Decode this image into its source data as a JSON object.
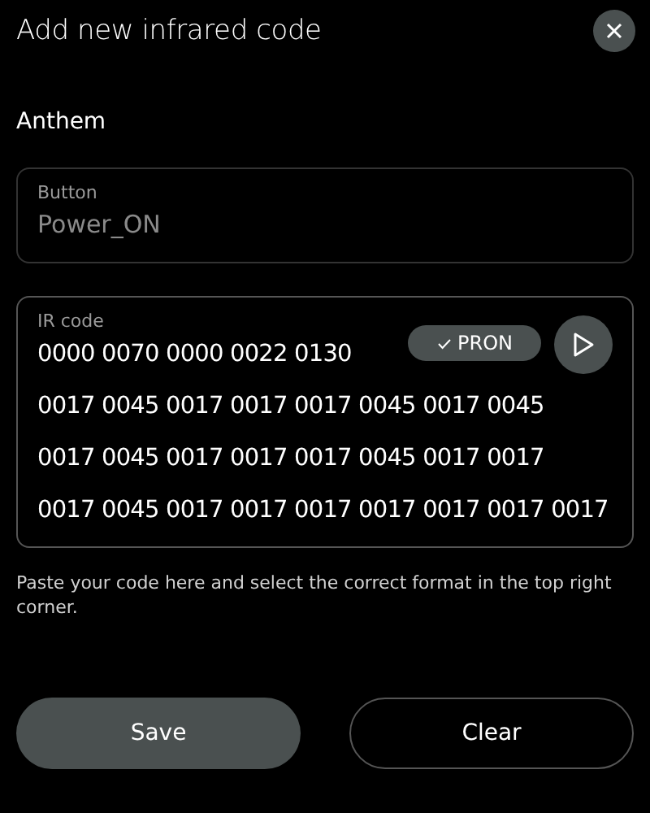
{
  "title": "Add new infrared code",
  "device": "Anthem",
  "button_field": {
    "label": "Button",
    "value": "Power_ON"
  },
  "ir_field": {
    "label": "IR code",
    "format": "PRON",
    "format_selected": true,
    "lines": [
      "0000 0070 0000 0022 0130",
      "0017 0045 0017 0017 0017 0045 0017 0045",
      "0017 0045 0017 0017 0017 0045 0017 0017",
      "0017 0045 0017 0017 0017 0017 0017 0017 0017"
    ]
  },
  "hint": "Paste your code here and select the correct format in the top right corner.",
  "buttons": [
    {
      "label": "Save",
      "kind": "filled"
    },
    {
      "label": "Clear",
      "kind": "outline"
    }
  ]
}
